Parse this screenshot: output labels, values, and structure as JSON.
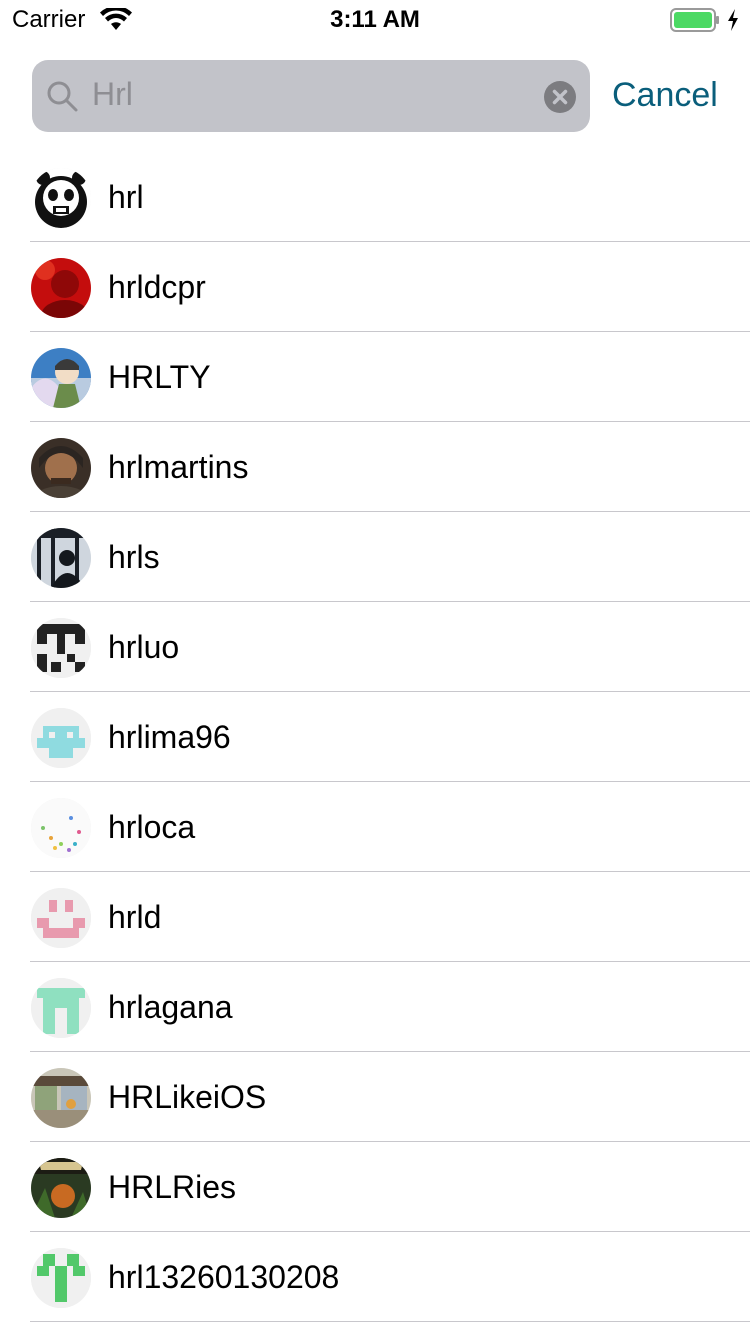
{
  "status_bar": {
    "carrier": "Carrier",
    "time": "3:11 AM",
    "icons": [
      "wifi-icon",
      "battery-icon",
      "charging-icon"
    ]
  },
  "search": {
    "query": "Hrl",
    "cancel_label": "Cancel",
    "icons": [
      "search-icon",
      "clear-icon"
    ]
  },
  "results": [
    {
      "username": "hrl",
      "avatar": "panda-avatar"
    },
    {
      "username": "hrldcpr",
      "avatar": "red-photo-avatar"
    },
    {
      "username": "HRLTY",
      "avatar": "anime-avatar"
    },
    {
      "username": "hrlmartins",
      "avatar": "hooded-man-avatar"
    },
    {
      "username": "hrls",
      "avatar": "silhouette-avatar"
    },
    {
      "username": "hrluo",
      "avatar": "black-identicon-avatar"
    },
    {
      "username": "hrlima96",
      "avatar": "teal-identicon-avatar"
    },
    {
      "username": "hrloca",
      "avatar": "confetti-avatar"
    },
    {
      "username": "hrld",
      "avatar": "pink-identicon-avatar"
    },
    {
      "username": "hrlagana",
      "avatar": "mint-identicon-avatar"
    },
    {
      "username": "HRLikeiOS",
      "avatar": "shop-photo-avatar"
    },
    {
      "username": "HRLRies",
      "avatar": "warriors-book-avatar"
    },
    {
      "username": "hrl13260130208",
      "avatar": "green-identicon-avatar"
    }
  ],
  "colors": {
    "search_field_bg": "#c2c3c9",
    "cancel": "#0a5e7b",
    "battery": "#4cd964",
    "divider": "#c8c7cc"
  }
}
